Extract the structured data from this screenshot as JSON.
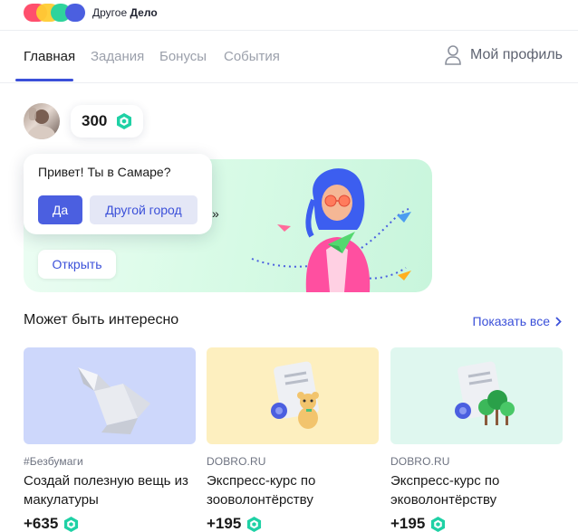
{
  "brand": {
    "name_regular": "Другое",
    "name_bold": "Дело",
    "colors": [
      "#ff4f6d",
      "#ffcc33",
      "#2fd39c",
      "#4b5fe0"
    ]
  },
  "nav": {
    "tabs": [
      {
        "label": "Главная",
        "active": true
      },
      {
        "label": "Задания",
        "active": false
      },
      {
        "label": "Бонусы",
        "active": false
      },
      {
        "label": "События",
        "active": false
      }
    ],
    "profile_label": "Мой профиль"
  },
  "user": {
    "balance": "300",
    "avatar_icon": "user-photo"
  },
  "city_prompt": {
    "question": "Привет! Ты в Самаре?",
    "yes_label": "Да",
    "other_label": "Другой город"
  },
  "hero": {
    "text_fragment": "»",
    "open_label": "Открыть"
  },
  "section": {
    "title": "Может быть интересно",
    "show_all": "Показать все"
  },
  "cards": [
    {
      "tag": "#Безбумаги",
      "title": "Создай полезную вещь из макулатуры",
      "points": "+635",
      "bg": "#cdd7fb",
      "icon": "paper-origami"
    },
    {
      "tag": "DOBRO.RU",
      "title": "Экспресс-курс по зооволонтёрству",
      "points": "+195",
      "bg": "#fdefbf",
      "icon": "certificate-teddy-bear"
    },
    {
      "tag": "DOBRO.RU",
      "title": "Экспресс-курс по эковолонтёрству",
      "points": "+195",
      "bg": "#dff7ef",
      "icon": "certificate-trees"
    }
  ],
  "colors": {
    "accent": "#3b50d9",
    "gem": "#1fd1a5"
  }
}
